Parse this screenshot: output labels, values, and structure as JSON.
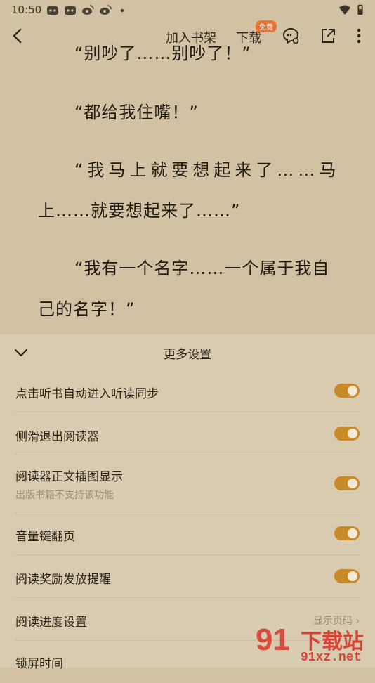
{
  "status": {
    "time": "10:50"
  },
  "topbar": {
    "add_shelf": "加入书架",
    "download": "下载",
    "badge": "免费"
  },
  "reader": {
    "p0": "“别吵了……别吵了！”",
    "p1": "“都给我住嘴！”",
    "p2a": "“我马上就要想起来了……马",
    "p2b": "上……就要想起来了……”",
    "p3a": "“我有一个名字……一个属于我自",
    "p3b": "己的名字！”"
  },
  "panel": {
    "title": "更多设置",
    "rows": [
      {
        "label": "点击听书自动进入听读同步",
        "on": true
      },
      {
        "label": "侧滑退出阅读器",
        "on": true
      },
      {
        "label": "阅读器正文插图显示",
        "sub": "出版书籍不支持该功能",
        "on": true
      },
      {
        "label": "音量键翻页",
        "on": true
      },
      {
        "label": "阅读奖励发放提醒",
        "on": true
      },
      {
        "label": "阅读进度设置",
        "value": "显示页码"
      },
      {
        "label": "锁屏时间"
      }
    ]
  },
  "watermark": {
    "brand": "下载站",
    "site": "91xz.net",
    "num": "91"
  },
  "colors": {
    "background": "#d2c2a3",
    "panel": "#d9cbaf",
    "toggle": "#c98a2a",
    "badge": "#e8743a",
    "watermark": "#d8352a"
  }
}
